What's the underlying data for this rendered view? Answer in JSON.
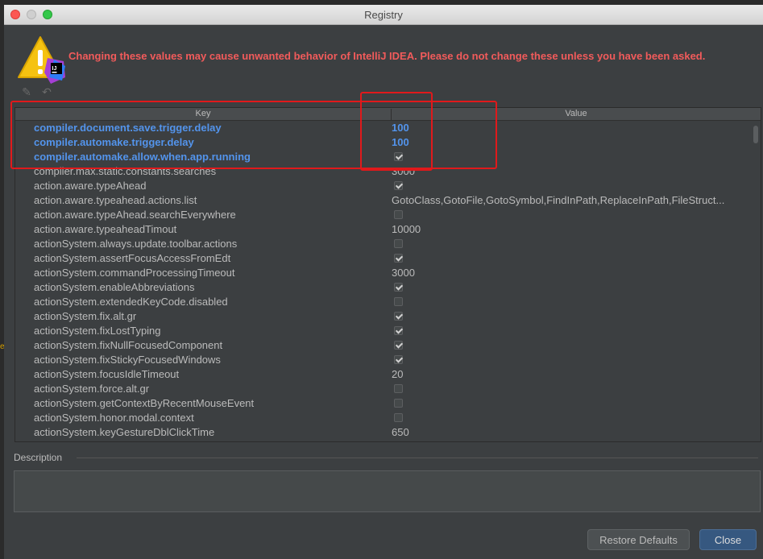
{
  "window": {
    "title": "Registry"
  },
  "warning": "Changing these values may cause unwanted behavior of IntelliJ IDEA. Please do not change these unless you have been asked.",
  "icons": {
    "warning": "warning-icon",
    "edit": "pencil-icon",
    "revert": "undo-icon",
    "app": "intellij-icon"
  },
  "columns": {
    "key": "Key",
    "value": "Value"
  },
  "rows": [
    {
      "key": "compiler.document.save.trigger.delay",
      "value": "100",
      "highlighted": true
    },
    {
      "key": "compiler.automake.trigger.delay",
      "value": "100",
      "highlighted": true
    },
    {
      "key": "compiler.automake.allow.when.app.running",
      "checkbox": true,
      "checked": true,
      "highlighted": true
    },
    {
      "key": "compiler.max.static.constants.searches",
      "value": "3000"
    },
    {
      "key": "action.aware.typeAhead",
      "checkbox": true,
      "checked": true
    },
    {
      "key": "action.aware.typeahead.actions.list",
      "value": "GotoClass,GotoFile,GotoSymbol,FindInPath,ReplaceInPath,FileStruct..."
    },
    {
      "key": "action.aware.typeAhead.searchEverywhere",
      "checkbox": true,
      "checked": false
    },
    {
      "key": "action.aware.typeaheadTimout",
      "value": "10000"
    },
    {
      "key": "actionSystem.always.update.toolbar.actions",
      "checkbox": true,
      "checked": false
    },
    {
      "key": "actionSystem.assertFocusAccessFromEdt",
      "checkbox": true,
      "checked": true
    },
    {
      "key": "actionSystem.commandProcessingTimeout",
      "value": "3000"
    },
    {
      "key": "actionSystem.enableAbbreviations",
      "checkbox": true,
      "checked": true
    },
    {
      "key": "actionSystem.extendedKeyCode.disabled",
      "checkbox": true,
      "checked": false
    },
    {
      "key": "actionSystem.fix.alt.gr",
      "checkbox": true,
      "checked": true
    },
    {
      "key": "actionSystem.fixLostTyping",
      "checkbox": true,
      "checked": true
    },
    {
      "key": "actionSystem.fixNullFocusedComponent",
      "checkbox": true,
      "checked": true
    },
    {
      "key": "actionSystem.fixStickyFocusedWindows",
      "checkbox": true,
      "checked": true
    },
    {
      "key": "actionSystem.focusIdleTimeout",
      "value": "20"
    },
    {
      "key": "actionSystem.force.alt.gr",
      "checkbox": true,
      "checked": false
    },
    {
      "key": "actionSystem.getContextByRecentMouseEvent",
      "checkbox": true,
      "checked": false
    },
    {
      "key": "actionSystem.honor.modal.context",
      "checkbox": true,
      "checked": false
    },
    {
      "key": "actionSystem.keyGestureDblClickTime",
      "value": "650"
    }
  ],
  "description": {
    "label": "Description",
    "value": ""
  },
  "buttons": {
    "restore": "Restore Defaults",
    "close": "Close"
  },
  "colors": {
    "highlight": "#5394ec",
    "warning": "#f25b5b",
    "annotation": "#e0191b",
    "primary_button": "#365880"
  }
}
